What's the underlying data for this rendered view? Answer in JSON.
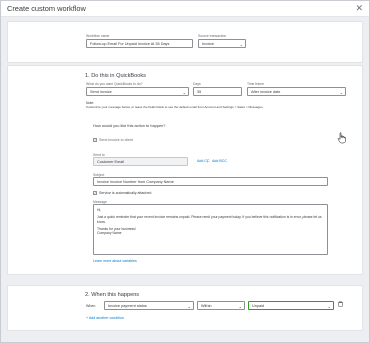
{
  "header": {
    "title": "Create custom workflow"
  },
  "top": {
    "workflow_name_label": "Workflow name",
    "workflow_name_value": "Follow-up Email For Unpaid Invoice At 35 Days",
    "source_label": "Source transaction",
    "source_value": "Invoice"
  },
  "section1": {
    "title": "1. Do this in QuickBooks",
    "action_label": "What do you want QuickBooks to do?",
    "action_value": "Send invoice",
    "days_label": "Days",
    "days_value": "35",
    "time_frame_label": "Time frame",
    "time_frame_value": "After invoice date",
    "note_title": "Note:",
    "note_text": "Customize your message below, or leave the fields blank to use the default email from Account and Settings > Sales > Messages.",
    "how_label": "How would you like this action to happen?",
    "send_to_client_label": "Send invoice to client",
    "send_to_label": "Send to",
    "send_to_value": "Customer Email",
    "add_cc": "Add CC",
    "add_bcc": "Add BCC",
    "subject_label": "Subject",
    "subject_value": "Invoice Invoice Number from Company Name",
    "attach_label": "Service is automatically attached",
    "message_label": "Message",
    "message_lines": [
      "Hi,",
      "Just a quick reminder that your recent invoice remains unpaid. Please remit your payment today. If you believe this notification is in error, please let us know.",
      "Thanks for your business!\nCompany Name"
    ],
    "learn_more": "Learn more about variables"
  },
  "section2": {
    "title": "2. When this happens",
    "when_label": "When",
    "field_value": "Invoice payment status",
    "operator_value": "Within",
    "status_value": "Unpaid",
    "add_condition": "+ Add another condition"
  },
  "colors": {
    "accent_green": "#2ca01c",
    "link_blue": "#0077c5"
  }
}
